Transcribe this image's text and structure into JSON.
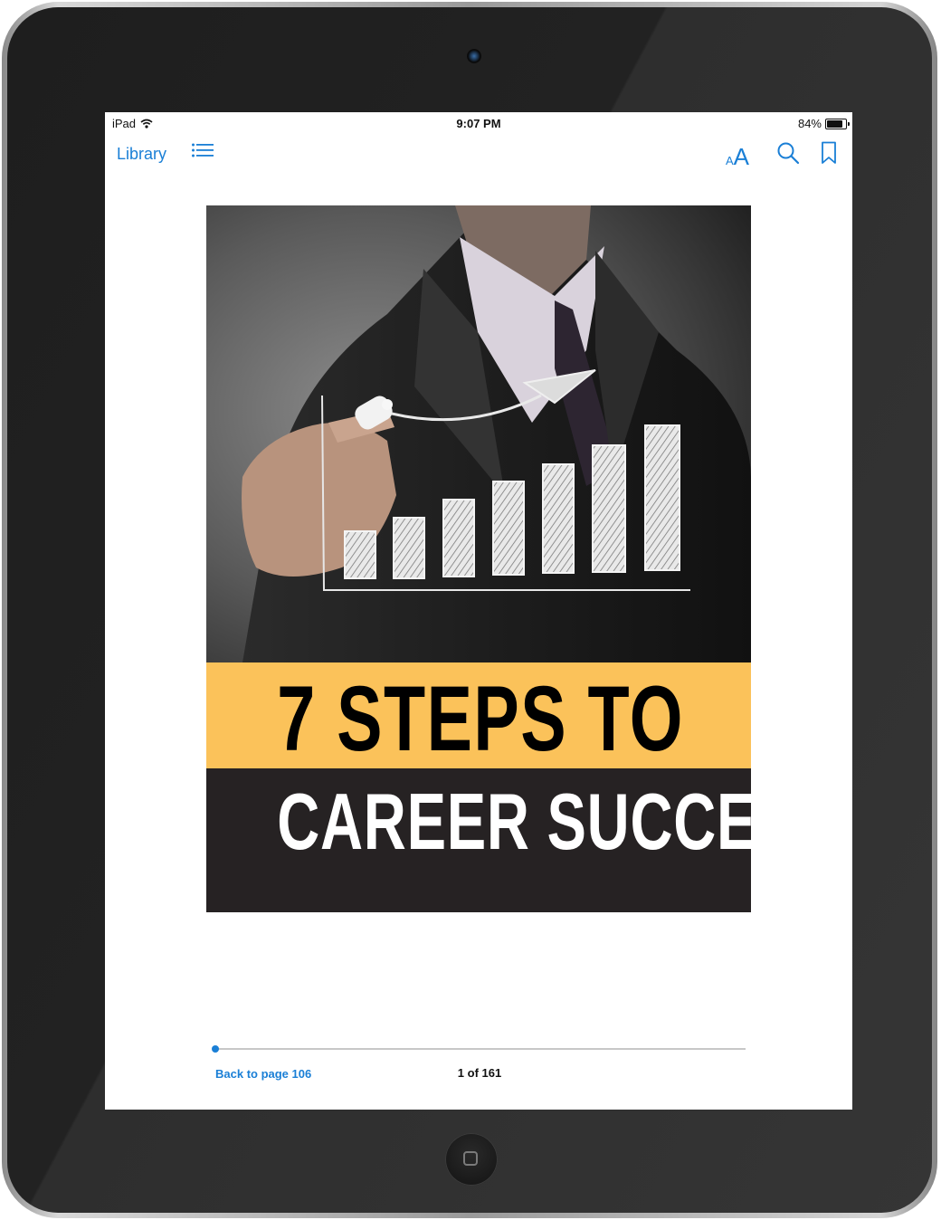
{
  "status_bar": {
    "device": "iPad",
    "time": "9:07 PM",
    "battery_text": "84%",
    "battery_level": 0.84
  },
  "toolbar": {
    "library_label": "Library",
    "toc_icon": "list-icon",
    "font_icon_small": "A",
    "font_icon_large": "A",
    "search_icon": "search-icon",
    "bookmark_icon": "bookmark-icon"
  },
  "book_cover": {
    "title_line1": "7 STEPS TO",
    "title_line2": "CAREER SUCCESS",
    "band_color_top": "#fbc25a",
    "band_color_bottom": "#262223"
  },
  "footer": {
    "back_link": "Back to page 106",
    "page_indicator": "1 of 161",
    "progress": 0.0
  },
  "colors": {
    "accent": "#1a7fd6"
  }
}
